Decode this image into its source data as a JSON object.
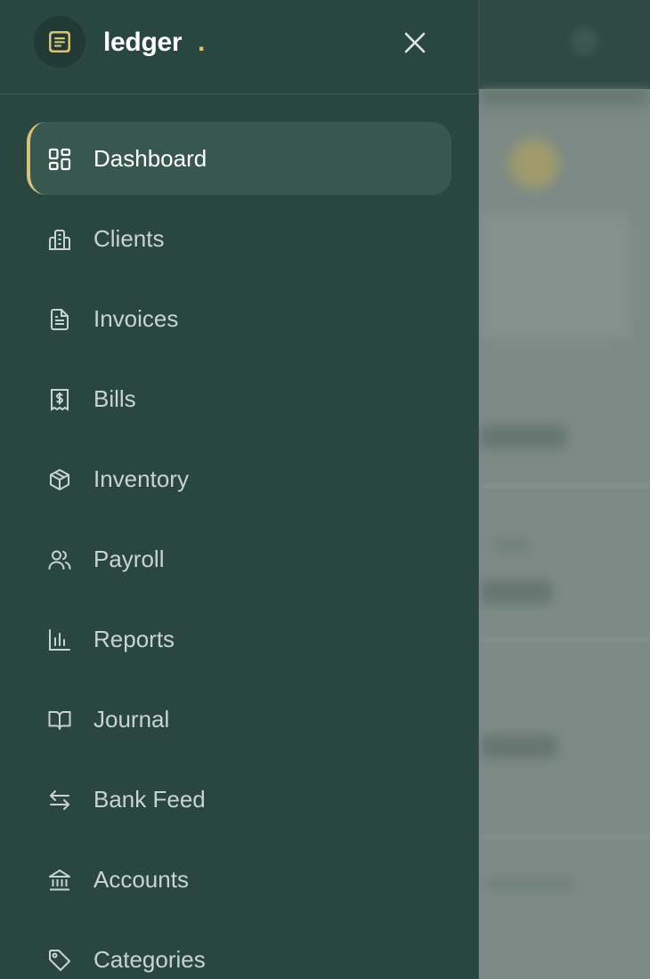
{
  "app": {
    "brand_name": "ledger",
    "brand_dot": ".",
    "logo_icon": "document-notes-icon",
    "close_icon": "close-icon"
  },
  "colors": {
    "drawer_bg": "#2a4640",
    "active_item_bg": "#37574f",
    "accent": "#d8c27a",
    "text_active": "#ffffff",
    "text_inactive": "#c9d3cf"
  },
  "nav": {
    "active_index": 0,
    "items": [
      {
        "label": "Dashboard",
        "icon": "dashboard-grid-icon"
      },
      {
        "label": "Clients",
        "icon": "building-icon"
      },
      {
        "label": "Invoices",
        "icon": "document-icon"
      },
      {
        "label": "Bills",
        "icon": "receipt-dollar-icon"
      },
      {
        "label": "Inventory",
        "icon": "box-icon"
      },
      {
        "label": "Payroll",
        "icon": "users-icon"
      },
      {
        "label": "Reports",
        "icon": "bar-chart-icon"
      },
      {
        "label": "Journal",
        "icon": "book-open-icon"
      },
      {
        "label": "Bank Feed",
        "icon": "arrows-swap-icon"
      },
      {
        "label": "Accounts",
        "icon": "bank-icon"
      },
      {
        "label": "Categories",
        "icon": "tag-icon"
      }
    ]
  }
}
